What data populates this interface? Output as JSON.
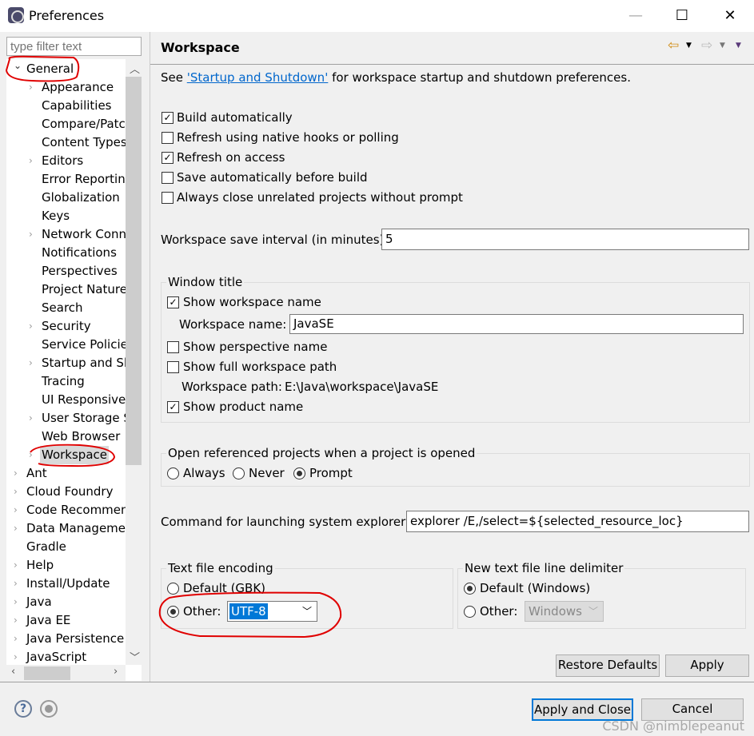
{
  "window": {
    "title": "Preferences",
    "minimize": "—",
    "maximize": "☐",
    "close": "✕"
  },
  "filter": {
    "placeholder": "type filter text"
  },
  "tree": [
    {
      "label": "General",
      "level": 0,
      "expanded": true
    },
    {
      "label": "Appearance",
      "level": 1,
      "expandable": true
    },
    {
      "label": "Capabilities",
      "level": 1
    },
    {
      "label": "Compare/Patch",
      "level": 1
    },
    {
      "label": "Content Types",
      "level": 1
    },
    {
      "label": "Editors",
      "level": 1,
      "expandable": true
    },
    {
      "label": "Error Reporting",
      "level": 1
    },
    {
      "label": "Globalization",
      "level": 1
    },
    {
      "label": "Keys",
      "level": 1
    },
    {
      "label": "Network Connections",
      "level": 1,
      "expandable": true
    },
    {
      "label": "Notifications",
      "level": 1
    },
    {
      "label": "Perspectives",
      "level": 1
    },
    {
      "label": "Project Natures",
      "level": 1
    },
    {
      "label": "Search",
      "level": 1
    },
    {
      "label": "Security",
      "level": 1,
      "expandable": true
    },
    {
      "label": "Service Policies",
      "level": 1
    },
    {
      "label": "Startup and Shutdown",
      "level": 1,
      "expandable": true
    },
    {
      "label": "Tracing",
      "level": 1
    },
    {
      "label": "UI Responsiveness",
      "level": 1
    },
    {
      "label": "User Storage Service",
      "level": 1,
      "expandable": true
    },
    {
      "label": "Web Browser",
      "level": 1
    },
    {
      "label": "Workspace",
      "level": 1,
      "expandable": true,
      "selected": true
    },
    {
      "label": "Ant",
      "level": 0,
      "expandable": true
    },
    {
      "label": "Cloud Foundry",
      "level": 0,
      "expandable": true
    },
    {
      "label": "Code Recommenders",
      "level": 0,
      "expandable": true
    },
    {
      "label": "Data Management",
      "level": 0,
      "expandable": true
    },
    {
      "label": "Gradle",
      "level": 0
    },
    {
      "label": "Help",
      "level": 0,
      "expandable": true
    },
    {
      "label": "Install/Update",
      "level": 0,
      "expandable": true
    },
    {
      "label": "Java",
      "level": 0,
      "expandable": true
    },
    {
      "label": "Java EE",
      "level": 0,
      "expandable": true
    },
    {
      "label": "Java Persistence",
      "level": 0,
      "expandable": true
    },
    {
      "label": "JavaScript",
      "level": 0,
      "expandable": true
    }
  ],
  "page": {
    "title": "Workspace",
    "see_prefix": "See ",
    "see_link": "'Startup and Shutdown'",
    "see_suffix": " for workspace startup and shutdown preferences.",
    "options": [
      {
        "label": "Build automatically",
        "checked": true
      },
      {
        "label": "Refresh using native hooks or polling",
        "checked": false
      },
      {
        "label": "Refresh on access",
        "checked": true
      },
      {
        "label": "Save automatically before build",
        "checked": false
      },
      {
        "label": "Always close unrelated projects without prompt",
        "checked": false
      }
    ],
    "save_interval_label": "Workspace save interval (in minutes):",
    "save_interval_value": "5",
    "window_title": {
      "legend": "Window title",
      "show_workspace_name": {
        "label": "Show workspace name",
        "checked": true
      },
      "workspace_name_label": "Workspace name:",
      "workspace_name_value": "JavaSE",
      "show_perspective_name": {
        "label": "Show perspective name",
        "checked": false
      },
      "show_full_path": {
        "label": "Show full workspace path",
        "checked": false
      },
      "workspace_path_label": "Workspace path:",
      "workspace_path_value": "E:\\Java\\workspace\\JavaSE",
      "show_product_name": {
        "label": "Show product name",
        "checked": true
      }
    },
    "open_referenced": {
      "legend": "Open referenced projects when a project is opened",
      "options": [
        "Always",
        "Never",
        "Prompt"
      ],
      "selected": "Prompt"
    },
    "explorer_label": "Command for launching system explorer:",
    "explorer_value": "explorer /E,/select=${selected_resource_loc}",
    "encoding": {
      "legend": "Text file encoding",
      "default_label": "Default (GBK)",
      "other_label": "Other:",
      "selected": "Other",
      "other_value": "UTF-8"
    },
    "line_delimiter": {
      "legend": "New text file line delimiter",
      "default_label": "Default (Windows)",
      "other_label": "Other:",
      "selected": "Default",
      "other_value": "Windows"
    },
    "restore_defaults": "Restore Defaults",
    "apply": "Apply"
  },
  "footer": {
    "apply_close": "Apply and Close",
    "cancel": "Cancel"
  },
  "watermark": "CSDN @nimblepeanut",
  "colors": {
    "accent": "#0078d7",
    "annotation": "#e00000",
    "link": "#0066cc"
  }
}
